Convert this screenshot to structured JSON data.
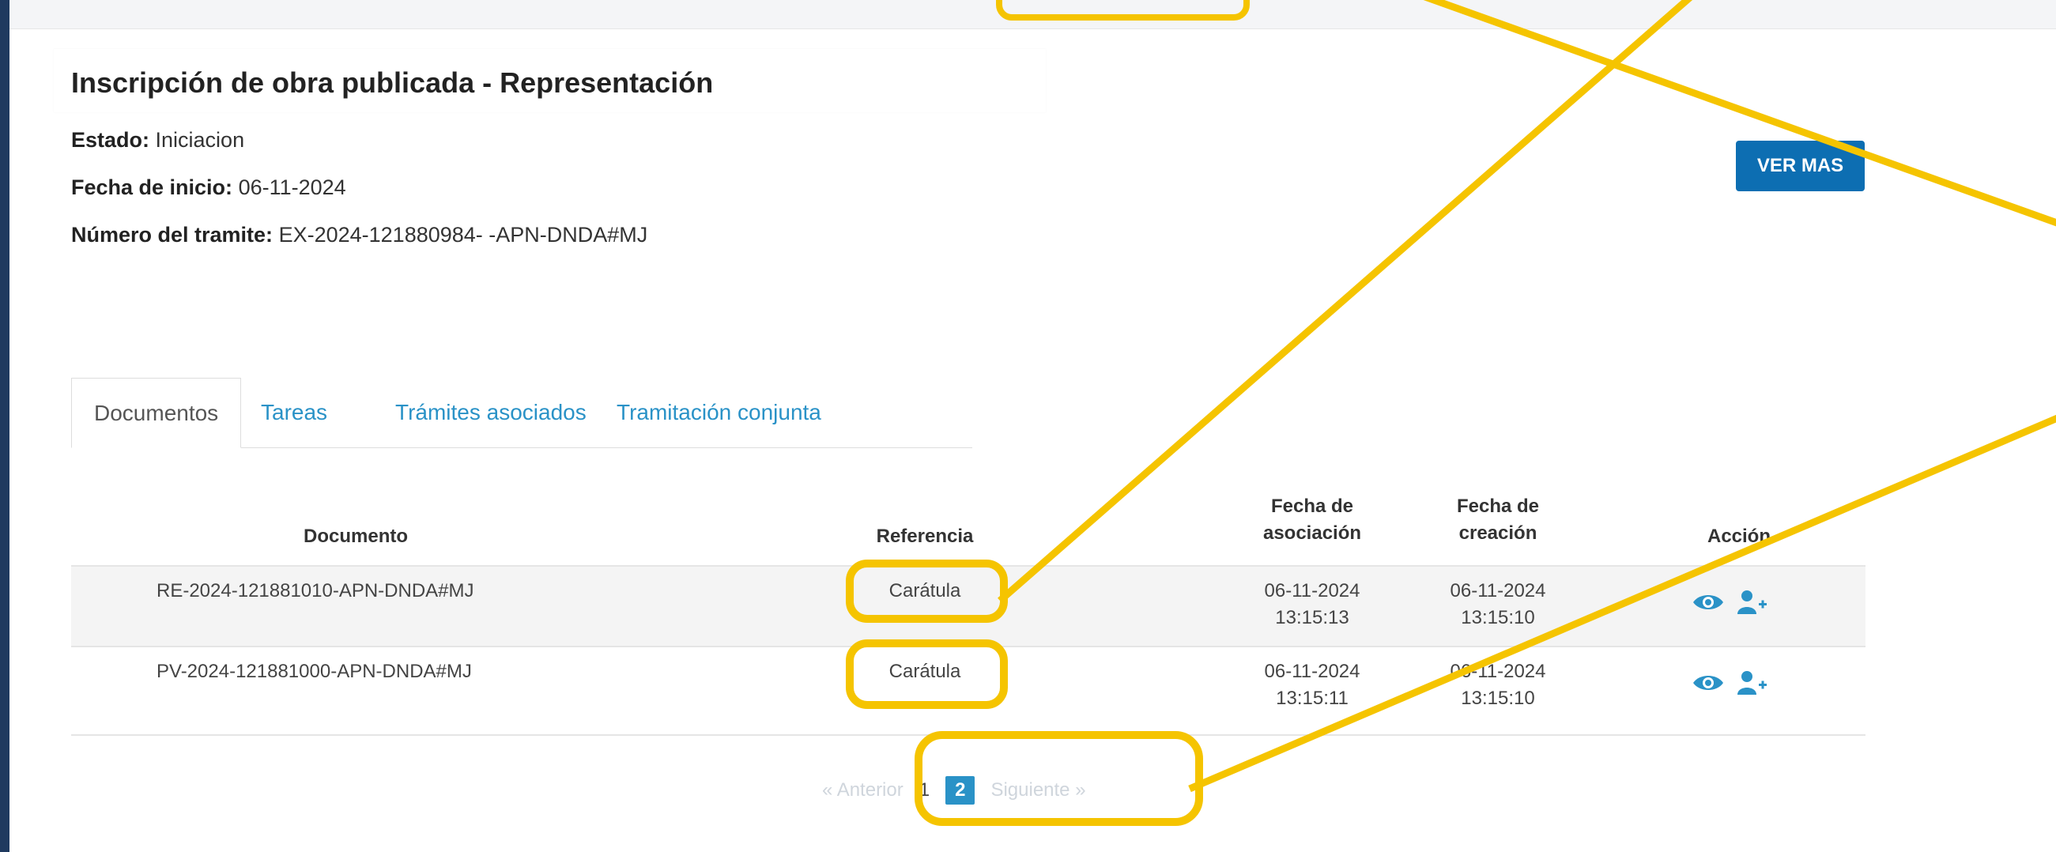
{
  "top": {
    "truncated_text": ""
  },
  "page": {
    "title": "Inscripción de obra publicada - Representación",
    "estado_label": "Estado:",
    "estado_value": "Iniciacion",
    "fecha_label": "Fecha de inicio:",
    "fecha_value": "06-11-2024",
    "numero_label": "Número del tramite:",
    "numero_value": "EX-2024-121880984- -APN-DNDA#MJ",
    "ver_mas": "VER MAS"
  },
  "tabs": [
    "Documentos",
    "Tareas",
    "Trámites asociados",
    "Tramitación conjunta"
  ],
  "table": {
    "headers": {
      "documento": "Documento",
      "referencia": "Referencia",
      "fecha_asociacion_1": "Fecha de",
      "fecha_asociacion_2": "asociación",
      "fecha_creacion_1": "Fecha de",
      "fecha_creacion_2": "creación",
      "accion": "Acción"
    },
    "rows": [
      {
        "documento": "RE-2024-121881010-APN-DNDA#MJ",
        "referencia": "Carátula",
        "asoc_fecha": "06-11-2024",
        "asoc_hora": "13:15:13",
        "crea_fecha": "06-11-2024",
        "crea_hora": "13:15:10"
      },
      {
        "documento": "PV-2024-121881000-APN-DNDA#MJ",
        "referencia": "Carátula",
        "asoc_fecha": "06-11-2024",
        "asoc_hora": "13:15:11",
        "crea_fecha": "06-11-2024",
        "crea_hora": "13:15:10"
      }
    ]
  },
  "pagination": {
    "prev": "« Anterior",
    "pages": [
      "1",
      "2"
    ],
    "active_page": "2",
    "next": "Siguiente »"
  },
  "colors": {
    "accent": "#0d6eb2",
    "tab_link": "#2a92c7",
    "highlight": "#f5c400",
    "sidebar": "#1f3a5f"
  },
  "icons": [
    "eye-icon",
    "add-user-icon"
  ]
}
